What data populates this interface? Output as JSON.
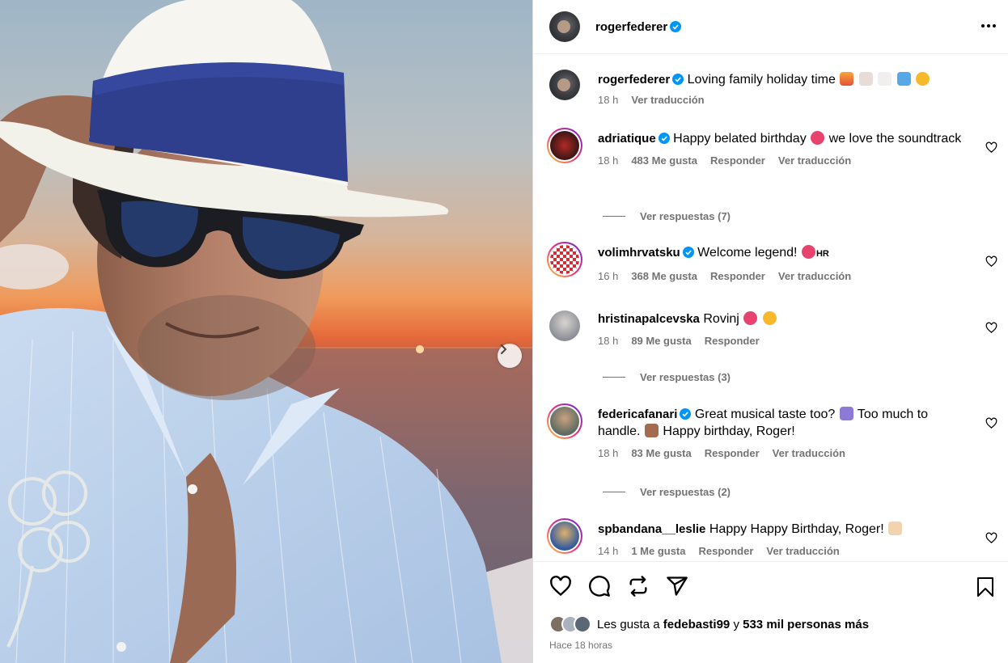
{
  "post": {
    "author": "rogerfederer",
    "more_label": "Más opciones"
  },
  "caption": {
    "username": "rogerfederer",
    "text": "Loving family holiday time",
    "time": "18 h",
    "translate": "Ver traducción"
  },
  "comments": [
    {
      "username": "adriatique",
      "verified": true,
      "text_before": "Happy belated birthday",
      "text_after": "we love the soundtrack",
      "time": "18 h",
      "likes": "483 Me gusta",
      "reply": "Responder",
      "translate": "Ver traducción",
      "replies": "Ver respuestas (7)"
    },
    {
      "username": "volimhrvatsku",
      "verified": true,
      "text_before": "Welcome legend!",
      "text_after": "HR",
      "time": "16 h",
      "likes": "368 Me gusta",
      "reply": "Responder",
      "translate": "Ver traducción"
    },
    {
      "username": "hristinapalcevska",
      "verified": false,
      "text_before": "Rovinj",
      "time": "18 h",
      "likes": "89 Me gusta",
      "reply": "Responder",
      "replies": "Ver respuestas (3)"
    },
    {
      "username": "federicafanari",
      "verified": true,
      "text_before": "Great musical taste too?",
      "text_mid": "Too much to handle.",
      "text_after": "Happy birthday, Roger!",
      "time": "18 h",
      "likes": "83 Me gusta",
      "reply": "Responder",
      "translate": "Ver traducción",
      "replies": "Ver respuestas (2)"
    },
    {
      "username": "spbandana__leslie",
      "verified": false,
      "text_before": "Happy Happy Birthday, Roger!",
      "time": "14 h",
      "likes": "1 Me gusta",
      "reply": "Responder",
      "translate": "Ver traducción"
    }
  ],
  "footer": {
    "likes_prefix": "Les gusta a",
    "likes_user": "fedebasti99",
    "likes_mid": "y",
    "likes_count": "533 mil personas más",
    "posted": "Hace 18 horas"
  },
  "colors": {
    "verified": "#0095f6",
    "secondary_text": "#737373",
    "border": "#dbdbdb"
  },
  "icons": [
    "heart-icon",
    "comment-icon",
    "repost-icon",
    "share-icon",
    "bookmark-icon",
    "verified-icon",
    "chevron-right-icon",
    "more-icon"
  ]
}
